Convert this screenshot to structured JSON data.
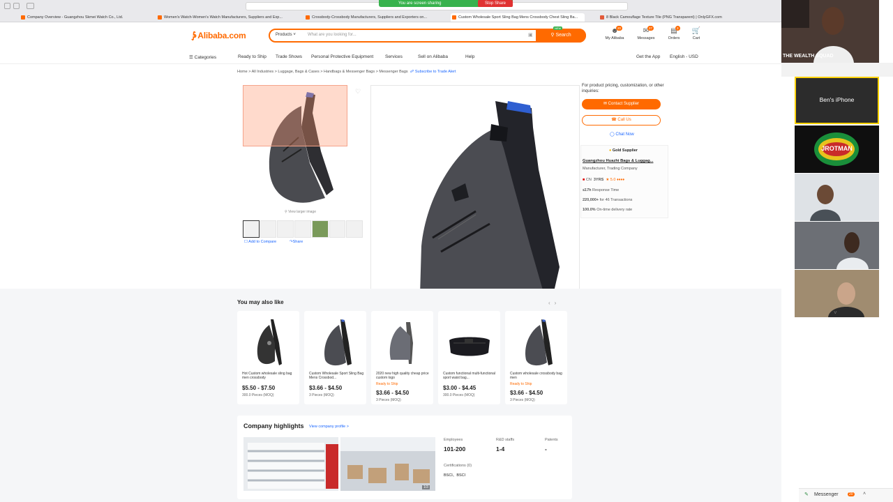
{
  "browser": {
    "tabs": [
      {
        "label": "Company Overview - Guangzhou Skmei Watch Co., Ltd."
      },
      {
        "label": "Women's Watch-Women's Watch Manufacturers, Suppliers and Exp..."
      },
      {
        "label": "Crossbody-Crossbody Manufacturers, Suppliers and Exporters on..."
      },
      {
        "label": "Custom Wholesale Sport Sling Bag Mens Crossbody Chest Sling Ba..."
      },
      {
        "label": "8 Black Camouflage Texture Tile (PNG Transparent) | OnlyGFX.com"
      }
    ],
    "screen_share_text": "You are screen sharing",
    "stop_share_label": "Stop Share"
  },
  "header": {
    "logo": "Alibaba.com",
    "search_category": "Products",
    "search_placeholder": "What are you looking for...",
    "search_button": "Search",
    "icons": [
      {
        "label": "My Alibaba",
        "icon": "user-icon",
        "badge": "20"
      },
      {
        "label": "Messages",
        "icon": "message-icon",
        "badge": "27"
      },
      {
        "label": "Orders",
        "icon": "orders-icon",
        "badge": "3"
      },
      {
        "label": "Cart",
        "icon": "cart-icon",
        "badge": ""
      }
    ],
    "new_badge": "NEW"
  },
  "nav": {
    "items": [
      "Categories",
      "Ready to Ship",
      "Trade Shows",
      "Personal Protective Equipment",
      "Services",
      "Sell on Alibaba",
      "Help"
    ],
    "get_app": "Get the App",
    "language": "English - USD"
  },
  "breadcrumb": {
    "items": [
      "Home",
      "All Industries",
      "Luggage, Bags & Cases",
      "Handbags & Messenger Bags",
      "Messenger Bags"
    ],
    "subscribe": "Subscribe to Trade Alert"
  },
  "gallery": {
    "view_larger": "View larger image",
    "add_compare": "Add to Compare",
    "share": "Share"
  },
  "supplier": {
    "note": "For product pricing, customization, or other inquiries:",
    "contact_button": "Contact Supplier",
    "call_button": "Call Us",
    "chat_now": "Chat Now",
    "gold": "Gold Supplier",
    "name": "Guangzhou Huazhi Bags & Luggag...",
    "type": "Manufacturer, Trading Company",
    "country": "CN",
    "years": "3YRS",
    "rating": "5.0",
    "response_value": "≤17h",
    "response_label": "Response Time",
    "transactions_value": "220,000+",
    "transactions_label": "for 46 Transactions",
    "ontime_value": "100.0%",
    "ontime_label": "On-time delivery rate"
  },
  "ymal": {
    "title": "You may also like",
    "cards": [
      {
        "title": "Hot Custom wholesale sling bag men crossbody",
        "rts": "",
        "price": "$5.50 - $7.50",
        "moq": "300.0 Pieces (MOQ)"
      },
      {
        "title": "Custom Wholesale Sport Sling Bag Mens Crossbod...",
        "rts": "",
        "price": "$3.66 - $4.50",
        "moq": "3 Pieces (MOQ)"
      },
      {
        "title": "2020 new high quality cheap price custom logo",
        "rts": "Ready to Ship",
        "price": "$3.66 - $4.50",
        "moq": "3 Pieces (MOQ)"
      },
      {
        "title": "Custom functional multi-functional sport waist bag...",
        "rts": "",
        "price": "$3.00 - $4.45",
        "moq": "300.0 Pieces (MOQ)"
      },
      {
        "title": "Custom wholesale crossbody bag men",
        "rts": "Ready to Ship",
        "price": "$3.66 - $4.50",
        "moq": "3 Pieces (MOQ)"
      }
    ]
  },
  "company": {
    "title": "Company highlights",
    "link": "View company profile >",
    "employees_label": "Employees",
    "employees_value": "101-200",
    "rd_label": "R&D staffs",
    "rd_value": "1-4",
    "patents_label": "Patents",
    "patents_value": "-",
    "cert_label": "Certifications (0)",
    "cert_value": "BSCI、BSCI",
    "photo_counter": "1/3"
  },
  "zoom": {
    "host_name": "THE WEALTH SQUAD",
    "device_tile": "Ben's iPhone",
    "logo_text": "JROTMAN",
    "messenger_label": "Messenger",
    "messenger_badge": "20"
  },
  "colors": {
    "brand": "#ff6a00",
    "link": "#1a66ff",
    "zoom_share": "#37b24d",
    "stop": "#e03131"
  }
}
